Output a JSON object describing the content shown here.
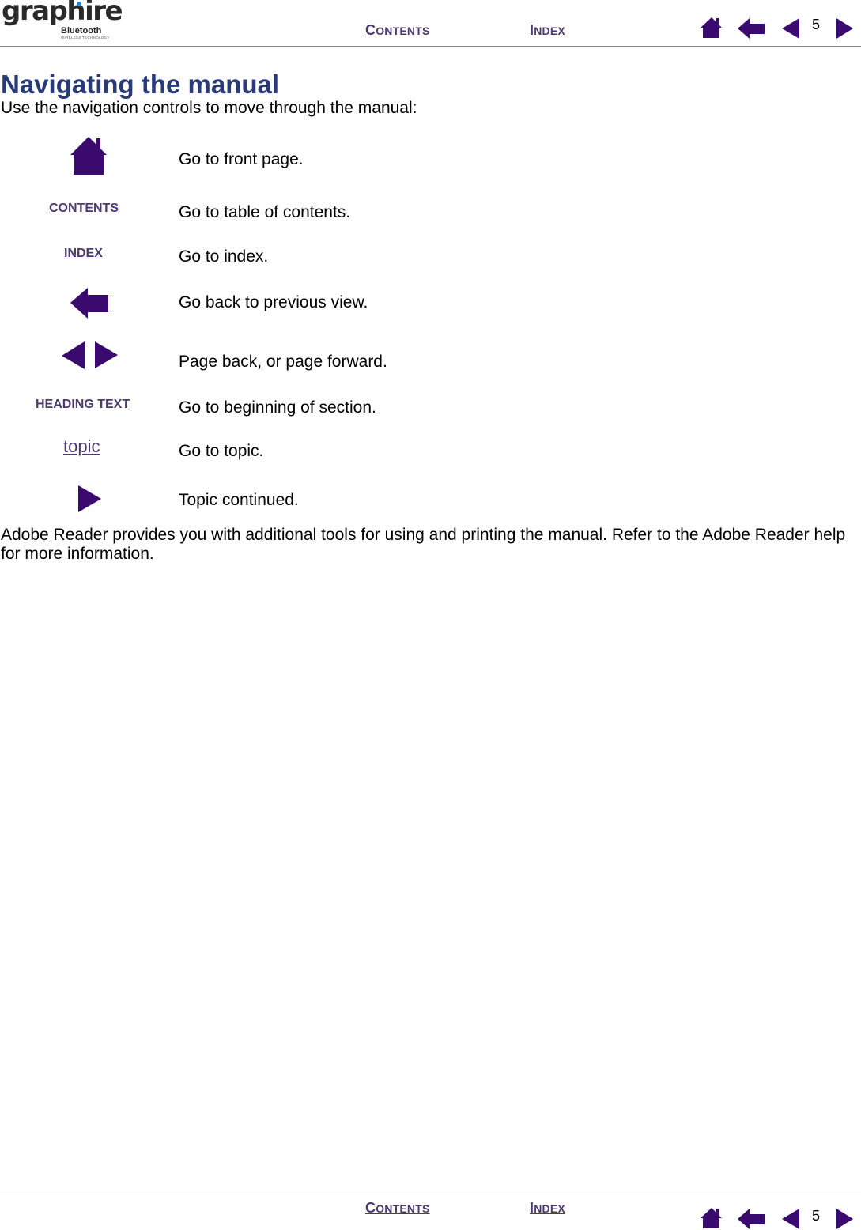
{
  "header": {
    "logo": {
      "brand": "graphire",
      "sub": "Bluetooth",
      "tagline": "WIRELESS TECHNOLOGY"
    },
    "contents": {
      "first": "C",
      "rest": "ONTENTS"
    },
    "index": {
      "first": "I",
      "rest": "NDEX"
    },
    "page_number": "5",
    "icons": [
      "home-icon",
      "back-view-icon",
      "page-back-icon",
      "page-forward-icon"
    ]
  },
  "main": {
    "title": "Navigating the manual",
    "intro": "Use the navigation controls to move through the manual:",
    "legend": [
      {
        "control": "home-icon",
        "description": "Go to front page."
      },
      {
        "control": "CONTENTS",
        "description": "Go to table of contents."
      },
      {
        "control": "INDEX",
        "description": "Go to index."
      },
      {
        "control": "back-view-icon",
        "description": "Go back to previous view."
      },
      {
        "control": "page-back-forward-icons",
        "description": "Page back, or page forward."
      },
      {
        "control": "HEADING TEXT",
        "description": "Go to beginning of section."
      },
      {
        "control": "topic",
        "description": "Go to topic."
      },
      {
        "control": "continue-icon",
        "description": "Topic continued."
      }
    ],
    "outro": "Adobe Reader provides you with additional tools for using and printing the manual.  Refer to the Adobe Reader help for more information."
  },
  "footer": {
    "contents": {
      "first": "C",
      "rest": "ONTENTS"
    },
    "index": {
      "first": "I",
      "rest": "NDEX"
    },
    "page_number": "5"
  },
  "colors": {
    "icon": "#3a0a6e",
    "link": "#4b3a6e",
    "heading": "#283a78",
    "rule": "#8a8a8a"
  }
}
